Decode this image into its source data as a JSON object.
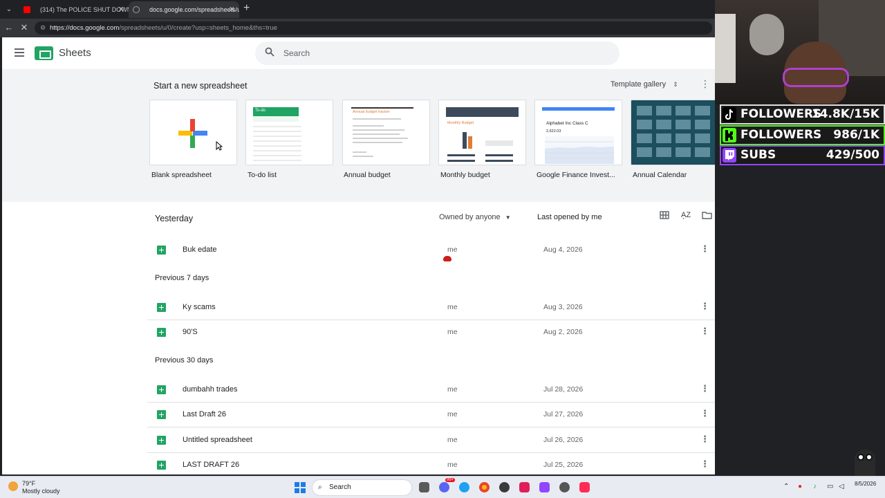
{
  "browser": {
    "tabs": [
      {
        "title": "(314) The POLICE SHUT DOWN Th",
        "active": false
      },
      {
        "title": "docs.google.com/spreadsheets/u/",
        "active": true
      }
    ],
    "url_host": "https://docs.google.com",
    "url_path": "/spreadsheets/u/0/create?usp=sheets_home&ths=true"
  },
  "app": {
    "name": "Sheets",
    "search_placeholder": "Search"
  },
  "templates": {
    "heading": "Start a new spreadsheet",
    "gallery_label": "Template gallery",
    "items": [
      {
        "label": "Blank spreadsheet"
      },
      {
        "label": "To-do list"
      },
      {
        "label": "Annual budget"
      },
      {
        "label": "Monthly budget"
      },
      {
        "label": "Google Finance Invest..."
      },
      {
        "label": "Annual Calendar"
      }
    ],
    "card_text": {
      "todo_title": "To-do",
      "budget_title": "Annual budget tracker",
      "monthly_title": "Monthly Budget",
      "finance_title": "Alphabet Inc Class C",
      "finance_value": "2,622.03"
    }
  },
  "recent": {
    "first_section": "Yesterday",
    "owner_filter": "Owned by anyone",
    "sort_label": "Last opened by me",
    "sections": [
      {
        "label": "Previous 7 days"
      },
      {
        "label": "Previous 30 days"
      }
    ],
    "files": [
      {
        "name": "Buk edate",
        "owner": "me",
        "date": "Aug 4, 2026"
      },
      {
        "name": "Ky scams",
        "owner": "me",
        "date": "Aug 3, 2026"
      },
      {
        "name": "90'S",
        "owner": "me",
        "date": "Aug 2, 2026"
      },
      {
        "name": "dumbahh trades",
        "owner": "me",
        "date": "Jul 28, 2026"
      },
      {
        "name": "Last Draft 26",
        "owner": "me",
        "date": "Jul 27, 2026"
      },
      {
        "name": "Untitled spreadsheet",
        "owner": "me",
        "date": "Jul 26, 2026"
      },
      {
        "name": "LAST DRAFT 26",
        "owner": "me",
        "date": "Jul 25, 2026"
      }
    ]
  },
  "overlay": {
    "stats": [
      {
        "label": "FOLLOWERS",
        "value": "14.8K/15K",
        "color": "#e0dfdf",
        "icon": "tiktok-icon"
      },
      {
        "label": "FOLLOWERS",
        "value": "986/1K",
        "color": "#53fc18",
        "icon": "kick-icon"
      },
      {
        "label": "SUBS",
        "value": "429/500",
        "color": "#9146ff",
        "icon": "twitch-icon"
      }
    ]
  },
  "taskbar": {
    "temp": "79°F",
    "condition": "Mostly cloudy",
    "search_label": "Search",
    "badge": "99+",
    "clock_time": "8/5/2026"
  },
  "colors": {
    "sheets_green": "#21a464",
    "template_bg": "#f1f3f4"
  }
}
